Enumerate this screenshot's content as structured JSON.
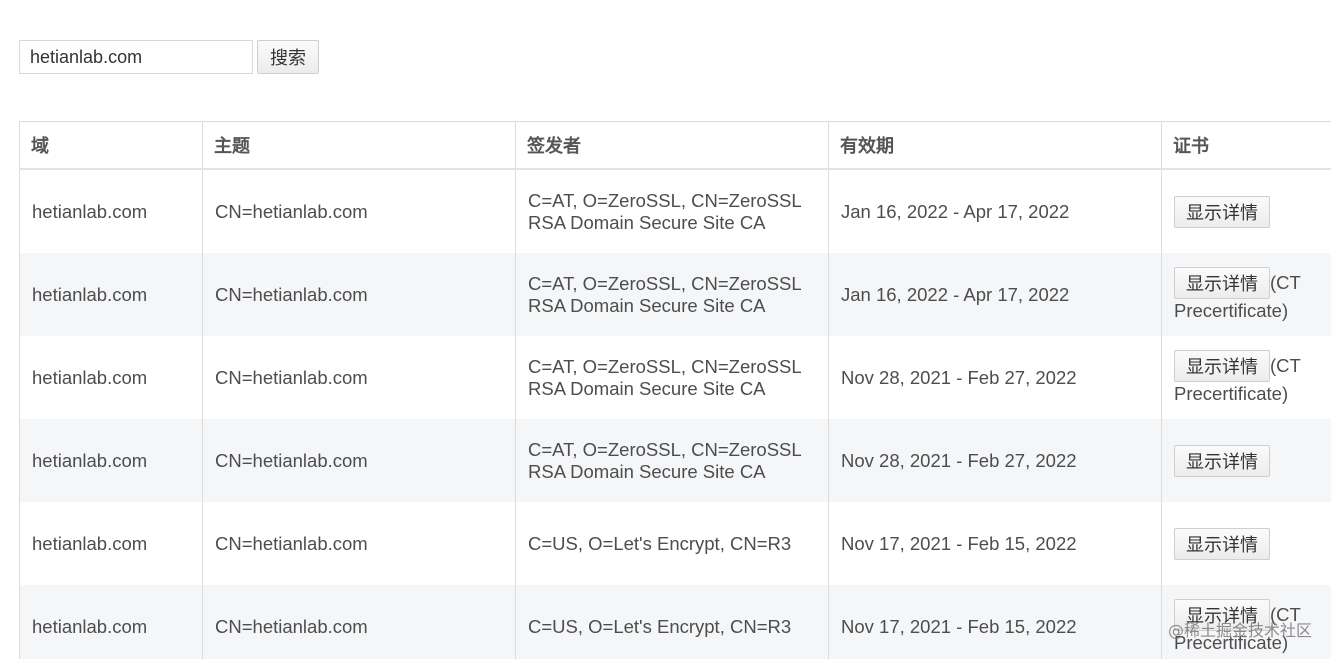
{
  "search": {
    "value": "hetianlab.com",
    "button_label": "搜索"
  },
  "table": {
    "headers": [
      "域",
      "主题",
      "签发者",
      "有效期",
      "证书"
    ],
    "rows": [
      {
        "domain": "hetianlab.com",
        "subject": "CN=hetianlab.com",
        "issuer_line1": "C=AT, O=ZeroSSL, CN=ZeroSSL",
        "issuer_line2": "RSA Domain Secure Site CA",
        "validity": "Jan 16, 2022 - Apr 17, 2022",
        "button_label": "显示详情",
        "note": ""
      },
      {
        "domain": "hetianlab.com",
        "subject": "CN=hetianlab.com",
        "issuer_line1": "C=AT, O=ZeroSSL, CN=ZeroSSL",
        "issuer_line2": "RSA Domain Secure Site CA",
        "validity": "Jan 16, 2022 - Apr 17, 2022",
        "button_label": "显示详情",
        "note": "(CT Precertificate)"
      },
      {
        "domain": "hetianlab.com",
        "subject": "CN=hetianlab.com",
        "issuer_line1": "C=AT, O=ZeroSSL, CN=ZeroSSL",
        "issuer_line2": "RSA Domain Secure Site CA",
        "validity": "Nov 28, 2021 - Feb 27, 2022",
        "button_label": "显示详情",
        "note": "(CT Precertificate)"
      },
      {
        "domain": "hetianlab.com",
        "subject": "CN=hetianlab.com",
        "issuer_line1": "C=AT, O=ZeroSSL, CN=ZeroSSL",
        "issuer_line2": "RSA Domain Secure Site CA",
        "validity": "Nov 28, 2021 - Feb 27, 2022",
        "button_label": "显示详情",
        "note": ""
      },
      {
        "domain": "hetianlab.com",
        "subject": "CN=hetianlab.com",
        "issuer_line1": "C=US, O=Let's Encrypt, CN=R3",
        "issuer_line2": "",
        "validity": "Nov 17, 2021 - Feb 15, 2022",
        "button_label": "显示详情",
        "note": ""
      },
      {
        "domain": "hetianlab.com",
        "subject": "CN=hetianlab.com",
        "issuer_line1": "C=US, O=Let's Encrypt, CN=R3",
        "issuer_line2": "",
        "validity": "Nov 17, 2021 - Feb 15, 2022",
        "button_label": "显示详情",
        "note": "(CT Precertificate)"
      }
    ]
  },
  "watermark": "@稀土掘金技术社区"
}
